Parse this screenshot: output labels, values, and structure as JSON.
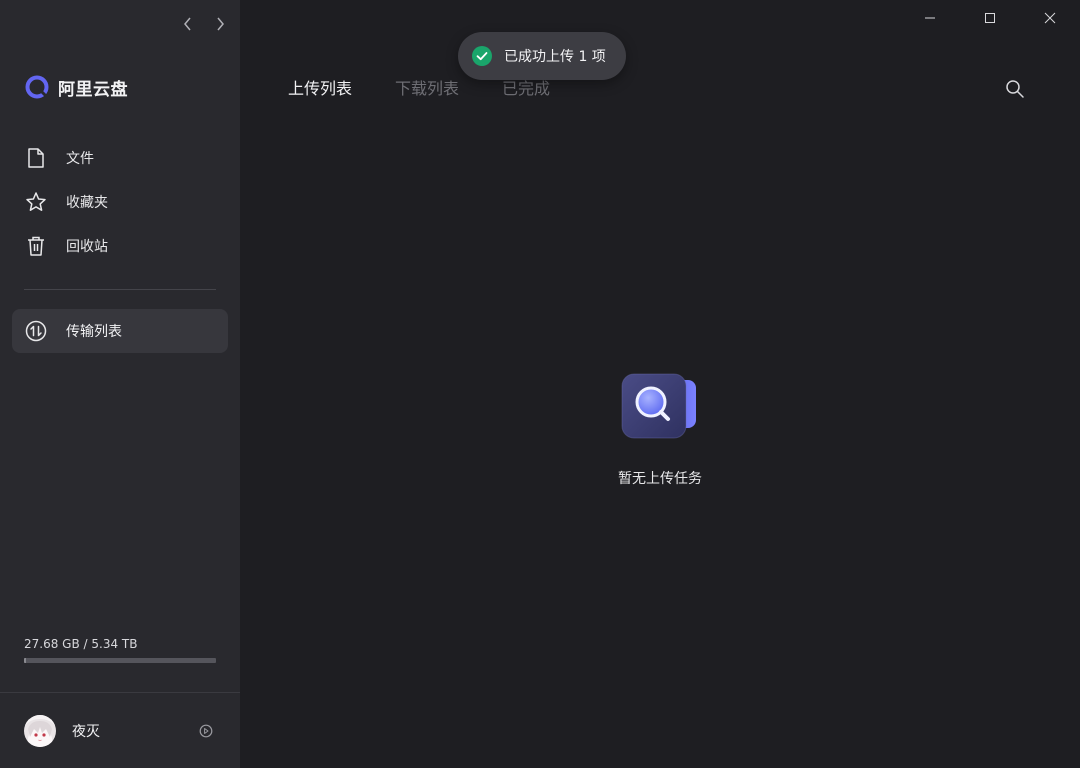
{
  "app": {
    "brand_name": "阿里云盘",
    "brand_color": "#6366f1"
  },
  "sidebar": {
    "nav_icons": [
      "chevron-left-icon",
      "chevron-right-icon"
    ],
    "items": [
      {
        "label": "文件",
        "icon": "file-icon"
      },
      {
        "label": "收藏夹",
        "icon": "star-icon"
      },
      {
        "label": "回收站",
        "icon": "trash-icon"
      }
    ],
    "transfer": {
      "label": "传输列表",
      "icon": "transfer-icon",
      "active": true
    },
    "storage": {
      "text": "27.68 GB / 5.34 TB",
      "used_fraction": 0.005
    },
    "user": {
      "name": "夜灭",
      "avatar_icon": "avatar",
      "settings_icon": "settings-icon"
    }
  },
  "main": {
    "tabs": [
      {
        "label": "上传列表",
        "active": true
      },
      {
        "label": "下载列表",
        "active": false
      },
      {
        "label": "已完成",
        "active": false
      }
    ],
    "search_icon": "search-icon",
    "empty_state": {
      "text": "暂无上传任务",
      "icon": "empty-search-illustration"
    }
  },
  "window_controls": [
    "minimize-icon",
    "maximize-icon",
    "close-icon"
  ],
  "toast": {
    "text": "已成功上传 1 项",
    "icon": "success-check-icon",
    "accent": "#1aa56b"
  }
}
